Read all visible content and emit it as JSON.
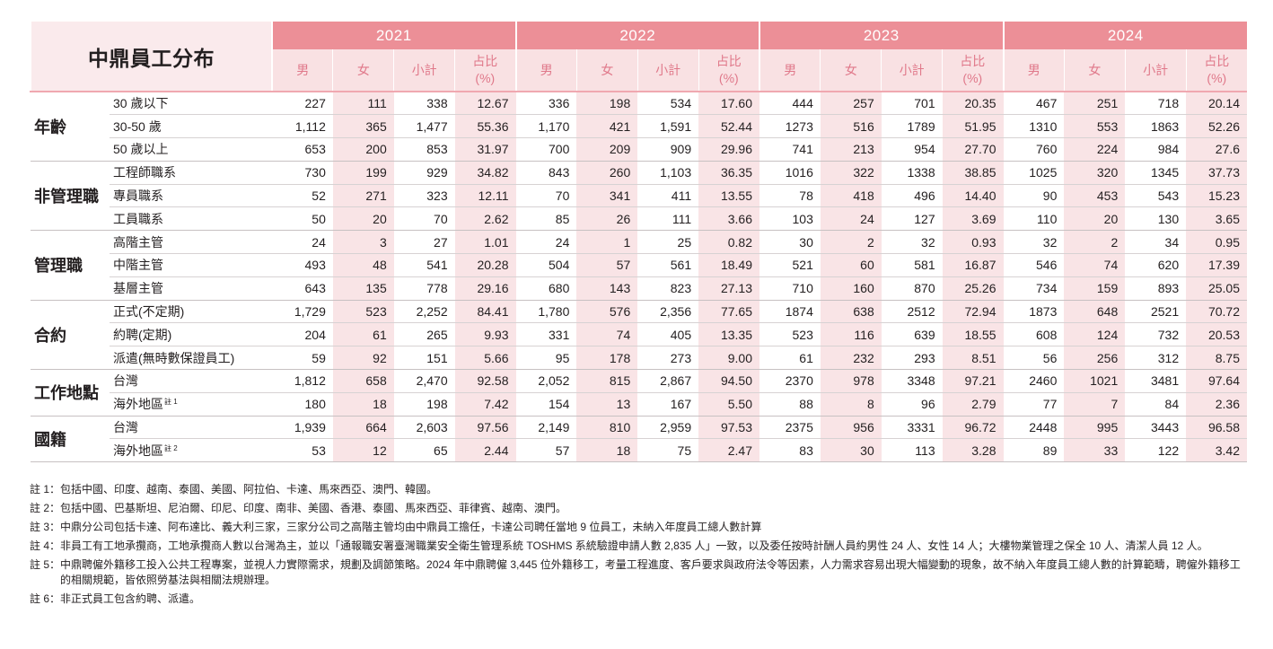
{
  "table": {
    "title": "中鼎員工分布",
    "years": [
      "2021",
      "2022",
      "2023",
      "2024"
    ],
    "subheaders": [
      "男",
      "女",
      "小計",
      "占比\n(%)"
    ],
    "groups": [
      {
        "name": "年齡",
        "rows": [
          {
            "label": "30 歲以下",
            "sup": "",
            "values": [
              "227",
              "111",
              "338",
              "12.67",
              "336",
              "198",
              "534",
              "17.60",
              "444",
              "257",
              "701",
              "20.35",
              "467",
              "251",
              "718",
              "20.14"
            ]
          },
          {
            "label": "30-50 歲",
            "sup": "",
            "values": [
              "1,112",
              "365",
              "1,477",
              "55.36",
              "1,170",
              "421",
              "1,591",
              "52.44",
              "1273",
              "516",
              "1789",
              "51.95",
              "1310",
              "553",
              "1863",
              "52.26"
            ]
          },
          {
            "label": "50 歲以上",
            "sup": "",
            "values": [
              "653",
              "200",
              "853",
              "31.97",
              "700",
              "209",
              "909",
              "29.96",
              "741",
              "213",
              "954",
              "27.70",
              "760",
              "224",
              "984",
              "27.6"
            ]
          }
        ]
      },
      {
        "name": "非管理職",
        "rows": [
          {
            "label": "工程師職系",
            "sup": "",
            "values": [
              "730",
              "199",
              "929",
              "34.82",
              "843",
              "260",
              "1,103",
              "36.35",
              "1016",
              "322",
              "1338",
              "38.85",
              "1025",
              "320",
              "1345",
              "37.73"
            ]
          },
          {
            "label": "專員職系",
            "sup": "",
            "values": [
              "52",
              "271",
              "323",
              "12.11",
              "70",
              "341",
              "411",
              "13.55",
              "78",
              "418",
              "496",
              "14.40",
              "90",
              "453",
              "543",
              "15.23"
            ]
          },
          {
            "label": "工員職系",
            "sup": "",
            "values": [
              "50",
              "20",
              "70",
              "2.62",
              "85",
              "26",
              "111",
              "3.66",
              "103",
              "24",
              "127",
              "3.69",
              "110",
              "20",
              "130",
              "3.65"
            ]
          }
        ]
      },
      {
        "name": "管理職",
        "rows": [
          {
            "label": "高階主管",
            "sup": "",
            "values": [
              "24",
              "3",
              "27",
              "1.01",
              "24",
              "1",
              "25",
              "0.82",
              "30",
              "2",
              "32",
              "0.93",
              "32",
              "2",
              "34",
              "0.95"
            ]
          },
          {
            "label": "中階主管",
            "sup": "",
            "values": [
              "493",
              "48",
              "541",
              "20.28",
              "504",
              "57",
              "561",
              "18.49",
              "521",
              "60",
              "581",
              "16.87",
              "546",
              "74",
              "620",
              "17.39"
            ]
          },
          {
            "label": "基層主管",
            "sup": "",
            "values": [
              "643",
              "135",
              "778",
              "29.16",
              "680",
              "143",
              "823",
              "27.13",
              "710",
              "160",
              "870",
              "25.26",
              "734",
              "159",
              "893",
              "25.05"
            ]
          }
        ]
      },
      {
        "name": "合約",
        "rows": [
          {
            "label": "正式(不定期)",
            "sup": "",
            "values": [
              "1,729",
              "523",
              "2,252",
              "84.41",
              "1,780",
              "576",
              "2,356",
              "77.65",
              "1874",
              "638",
              "2512",
              "72.94",
              "1873",
              "648",
              "2521",
              "70.72"
            ]
          },
          {
            "label": "約聘(定期)",
            "sup": "",
            "values": [
              "204",
              "61",
              "265",
              "9.93",
              "331",
              "74",
              "405",
              "13.35",
              "523",
              "116",
              "639",
              "18.55",
              "608",
              "124",
              "732",
              "20.53"
            ]
          },
          {
            "label": "派遣(無時數保證員工)",
            "sup": "",
            "values": [
              "59",
              "92",
              "151",
              "5.66",
              "95",
              "178",
              "273",
              "9.00",
              "61",
              "232",
              "293",
              "8.51",
              "56",
              "256",
              "312",
              "8.75"
            ]
          }
        ]
      },
      {
        "name": "工作地點",
        "rows": [
          {
            "label": "台灣",
            "sup": "",
            "values": [
              "1,812",
              "658",
              "2,470",
              "92.58",
              "2,052",
              "815",
              "2,867",
              "94.50",
              "2370",
              "978",
              "3348",
              "97.21",
              "2460",
              "1021",
              "3481",
              "97.64"
            ]
          },
          {
            "label": "海外地區",
            "sup": "註 1",
            "values": [
              "180",
              "18",
              "198",
              "7.42",
              "154",
              "13",
              "167",
              "5.50",
              "88",
              "8",
              "96",
              "2.79",
              "77",
              "7",
              "84",
              "2.36"
            ]
          }
        ]
      },
      {
        "name": "國籍",
        "rows": [
          {
            "label": "台灣",
            "sup": "",
            "values": [
              "1,939",
              "664",
              "2,603",
              "97.56",
              "2,149",
              "810",
              "2,959",
              "97.53",
              "2375",
              "956",
              "3331",
              "96.72",
              "2448",
              "995",
              "3443",
              "96.58"
            ]
          },
          {
            "label": "海外地區",
            "sup": "註 2",
            "values": [
              "53",
              "12",
              "65",
              "2.44",
              "57",
              "18",
              "75",
              "2.47",
              "83",
              "30",
              "113",
              "3.28",
              "89",
              "33",
              "122",
              "3.42"
            ]
          }
        ]
      }
    ]
  },
  "notes": [
    {
      "label": "註 1：",
      "text": "包括中國、印度、越南、泰國、美國、阿拉伯、卡達、馬來西亞、澳門、韓國。"
    },
    {
      "label": "註 2：",
      "text": "包括中國、巴基斯坦、尼泊爾、印尼、印度、南非、美國、香港、泰國、馬來西亞、菲律賓、越南、澳門。"
    },
    {
      "label": "註 3：",
      "text": "中鼎分公司包括卡達、阿布達比、義大利三家，三家分公司之高階主管均由中鼎員工擔任，卡達公司聘任當地 9 位員工，未納入年度員工總人數計算"
    },
    {
      "label": "註 4：",
      "text": "非員工有工地承攬商，工地承攬商人數以台灣為主，並以「通報職安署臺灣職業安全衛生管理系統 TOSHMS 系統驗證申請人數 2,835 人」一致，以及委任按時計酬人員約男性 24 人、女性 14 人；大樓物業管理之保全 10 人、清潔人員 12 人。"
    },
    {
      "label": "註 5：",
      "text": "中鼎聘僱外籍移工投入公共工程專案，並視人力實際需求，規劃及調節策略。2024 年中鼎聘僱 3,445 位外籍移工，考量工程進度、客戶要求與政府法令等因素，人力需求容易出現大幅變動的現象，故不納入年度員工總人數的計算範疇，聘僱外籍移工的相關規範，皆依照勞基法與相關法規辦理。"
    },
    {
      "label": "註 6：",
      "text": "非正式員工包含約聘、派遣。"
    }
  ]
}
